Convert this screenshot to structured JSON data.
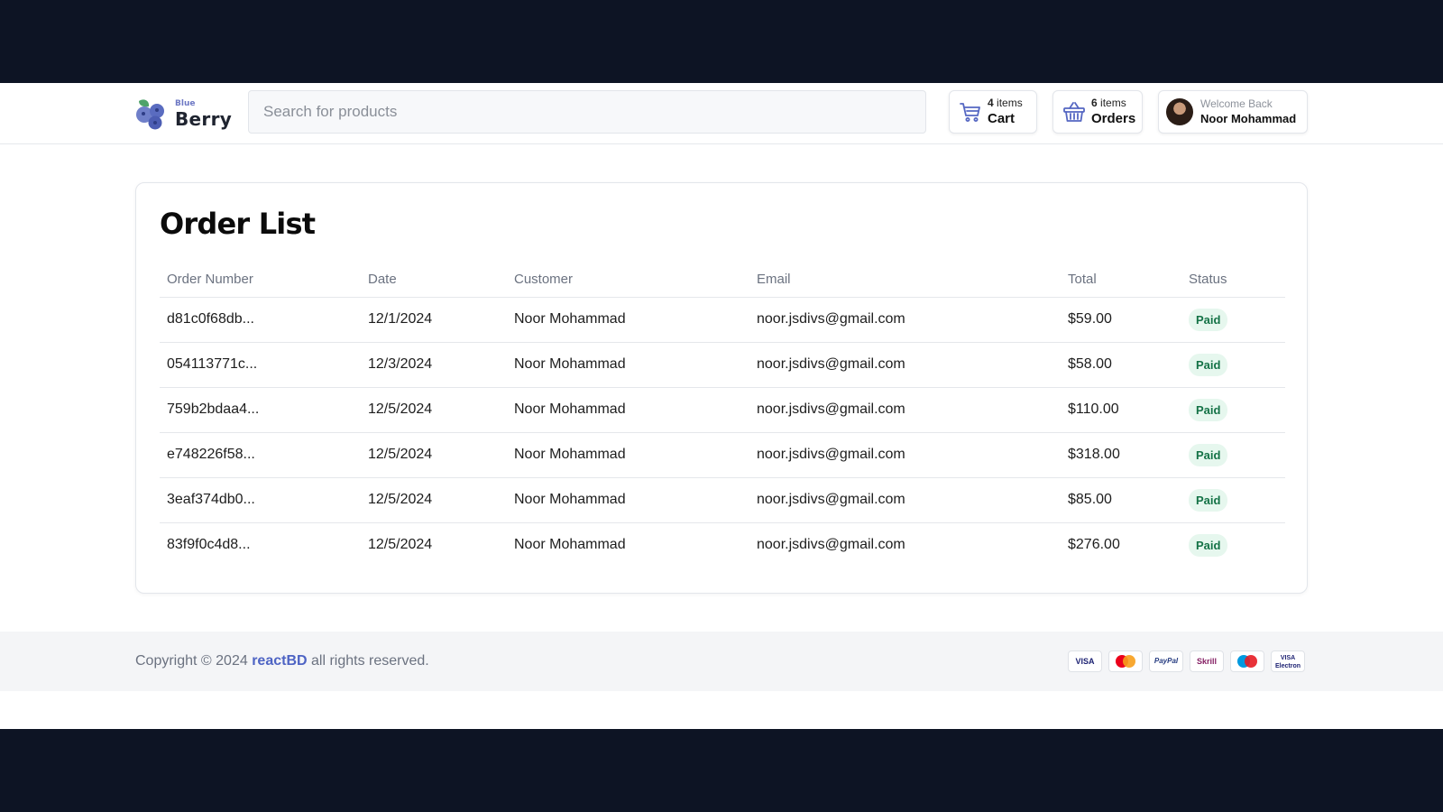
{
  "header": {
    "logo": {
      "small": "Blue",
      "big": "Berry"
    },
    "search_placeholder": "Search for products",
    "cart": {
      "count": "4",
      "count_suffix": "items",
      "label": "Cart",
      "icon": "cart-icon"
    },
    "orders": {
      "count": "6",
      "count_suffix": "items",
      "label": "Orders",
      "icon": "basket-icon"
    },
    "user": {
      "welcome": "Welcome Back",
      "name": "Noor Mohammad"
    }
  },
  "page": {
    "title": "Order List"
  },
  "table": {
    "columns": [
      "Order Number",
      "Date",
      "Customer",
      "Email",
      "Total",
      "Status"
    ],
    "rows": [
      {
        "order": "d81c0f68db...",
        "date": "12/1/2024",
        "customer": "Noor Mohammad",
        "email": "noor.jsdivs@gmail.com",
        "total": "$59.00",
        "status": "Paid"
      },
      {
        "order": "054113771c...",
        "date": "12/3/2024",
        "customer": "Noor Mohammad",
        "email": "noor.jsdivs@gmail.com",
        "total": "$58.00",
        "status": "Paid"
      },
      {
        "order": "759b2bdaa4...",
        "date": "12/5/2024",
        "customer": "Noor Mohammad",
        "email": "noor.jsdivs@gmail.com",
        "total": "$110.00",
        "status": "Paid"
      },
      {
        "order": "e748226f58...",
        "date": "12/5/2024",
        "customer": "Noor Mohammad",
        "email": "noor.jsdivs@gmail.com",
        "total": "$318.00",
        "status": "Paid"
      },
      {
        "order": "3eaf374db0...",
        "date": "12/5/2024",
        "customer": "Noor Mohammad",
        "email": "noor.jsdivs@gmail.com",
        "total": "$85.00",
        "status": "Paid"
      },
      {
        "order": "83f9f0c4d8...",
        "date": "12/5/2024",
        "customer": "Noor Mohammad",
        "email": "noor.jsdivs@gmail.com",
        "total": "$276.00",
        "status": "Paid"
      }
    ]
  },
  "footer": {
    "copyright_prefix": "Copyright © 2024",
    "brand": "reactBD",
    "copyright_suffix": "all rights reserved.",
    "payment_methods": [
      "VISA",
      "Mastercard",
      "PayPal",
      "Skrill",
      "Maestro",
      "VISA Electron"
    ]
  },
  "colors": {
    "accent": "#4e64c4",
    "paid_badge_bg": "#e6f7ee",
    "paid_badge_text": "#157347",
    "outer_background": "#0d1424"
  }
}
